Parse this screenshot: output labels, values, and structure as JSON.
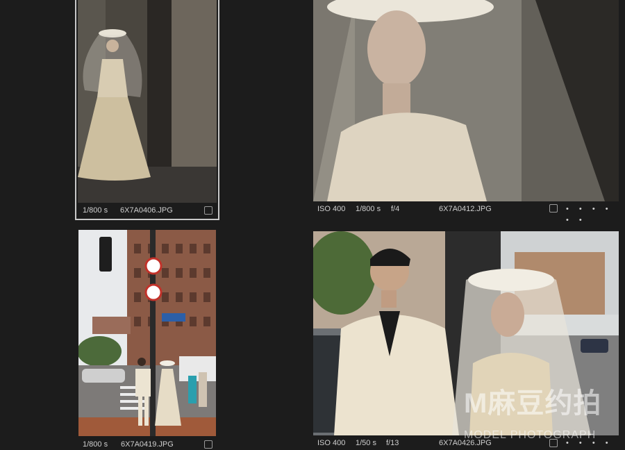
{
  "photos": [
    {
      "shutter": "1/800 s",
      "filename": "6X7A0406.JPG",
      "selected": true
    },
    {
      "iso": "ISO 400",
      "shutter": "1/800 s",
      "aperture": "f/4",
      "filename": "6X7A0412.JPG"
    },
    {
      "shutter": "1/800 s",
      "filename": "6X7A0419.JPG"
    },
    {
      "iso": "ISO 400",
      "shutter": "1/50 s",
      "aperture": "f/13",
      "filename": "6X7A0426.JPG"
    }
  ],
  "more_dots": "• • • • • •",
  "watermark": {
    "logo": "M麻豆约拍",
    "sub": "MODEL PHOTOGRAPH"
  },
  "colors": {
    "background": "#1c1c1c",
    "selection_border": "#c9c9c9",
    "text": "#cfcfcf"
  }
}
